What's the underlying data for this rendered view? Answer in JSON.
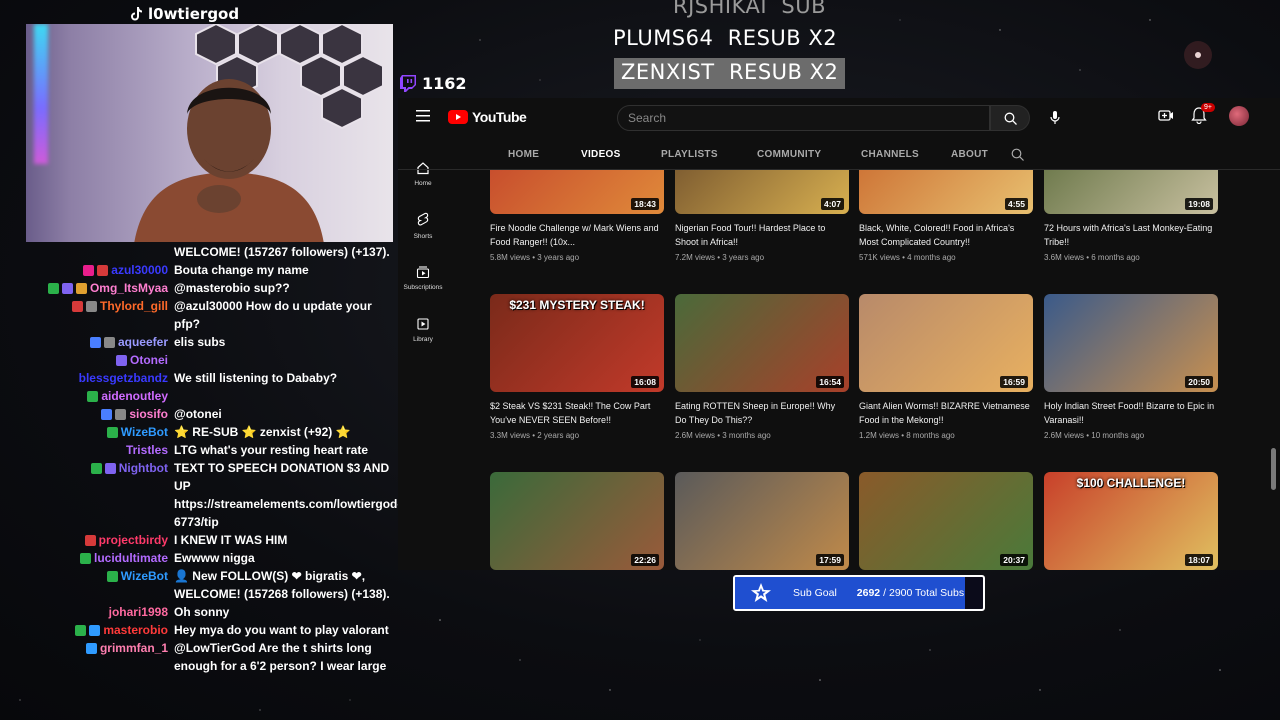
{
  "stream": {
    "channel_name": "l0wtiergod",
    "viewer_count": "1162"
  },
  "subtrain": [
    {
      "name": "RJSHIKAI",
      "action": "SUB"
    },
    {
      "name": "PLUMS64",
      "action": "RESUB X2"
    },
    {
      "name": "ZENXIST",
      "action": "RESUB X2"
    }
  ],
  "chat": [
    {
      "user": "",
      "color": "#ffffff",
      "text": "WELCOME! (157267 followers) (+137).",
      "badges": []
    },
    {
      "user": "azul30000",
      "color": "#3a3aff",
      "text": "Bouta change my name",
      "badges": [
        "#e91e8c",
        "#d63a3a"
      ]
    },
    {
      "user": "Omg_ItsMyaa",
      "color": "#ff7fd0",
      "text": "@masterobio sup??",
      "badges": [
        "#2bb14a",
        "#7f63f0",
        "#e0a030"
      ]
    },
    {
      "user": "Thylord_gill",
      "color": "#ff6a2a",
      "text": "@azul30000 How do u update your pfp?",
      "badges": [
        "#d63a3a",
        "#888888"
      ]
    },
    {
      "user": "aqueefer",
      "color": "#9a9aff",
      "text": "elis subs",
      "badges": [
        "#4a7fff",
        "#888888"
      ]
    },
    {
      "user": "Otonei",
      "color": "#b36bff",
      "text": "",
      "badges": [
        "#7f63f0"
      ]
    },
    {
      "user": "blessgetzbandz",
      "color": "#3a3aff",
      "text": "We still listening to Dababy?",
      "badges": []
    },
    {
      "user": "aidenoutley",
      "color": "#d06bff",
      "text": "",
      "badges": [
        "#2bb14a"
      ]
    },
    {
      "user": "siosifo",
      "color": "#ff7fd0",
      "text": "@otonei",
      "badges": [
        "#4a7fff",
        "#888888"
      ]
    },
    {
      "user": "WizeBot",
      "color": "#2f9bff",
      "text": "⭐ RE-SUB ⭐ zenxist (+92) ⭐",
      "badges": [
        "#2bb14a"
      ]
    },
    {
      "user": "Tristles",
      "color": "#b36bff",
      "text": "LTG what's your resting heart rate",
      "badges": []
    },
    {
      "user": "Nightbot",
      "color": "#7f63f0",
      "text": "TEXT TO SPEECH DONATION $3 AND UP https://streamelements.com/lowtiergod-6773/tip",
      "badges": [
        "#2bb14a",
        "#7f63f0"
      ]
    },
    {
      "user": "projectbirdy",
      "color": "#ff3a6a",
      "text": "I KNEW IT WAS HIM",
      "badges": [
        "#d63a3a"
      ]
    },
    {
      "user": "lucidultimate",
      "color": "#b36bff",
      "text": "Ewwww nigga",
      "badges": [
        "#2bb14a"
      ]
    },
    {
      "user": "WizeBot",
      "color": "#2f9bff",
      "text": "👤 New FOLLOW(S) ❤ bigratis ❤, WELCOME! (157268 followers) (+138).",
      "badges": [
        "#2bb14a"
      ]
    },
    {
      "user": "johari1998",
      "color": "#ff6aa0",
      "text": "Oh sonny",
      "badges": []
    },
    {
      "user": "masterobio",
      "color": "#ff3a3a",
      "text": "Hey mya do you want to play valorant",
      "badges": [
        "#2bb14a",
        "#2f9bff"
      ]
    },
    {
      "user": "grimmfan_1",
      "color": "#ff7fb0",
      "text": "@LowTierGod Are the t shirts long enough for a 6'2 person? I wear large",
      "badges": [
        "#2f9bff"
      ]
    }
  ],
  "youtube": {
    "logo": "YouTube",
    "search_placeholder": "Search",
    "notification_count": "9+",
    "sidebar": [
      {
        "label": "Home",
        "icon": "home-icon"
      },
      {
        "label": "Shorts",
        "icon": "shorts-icon"
      },
      {
        "label": "Subscriptions",
        "icon": "subscriptions-icon"
      },
      {
        "label": "Library",
        "icon": "library-icon"
      }
    ],
    "tabs": [
      "HOME",
      "VIDEOS",
      "PLAYLISTS",
      "COMMUNITY",
      "CHANNELS",
      "ABOUT"
    ],
    "active_tab": "VIDEOS",
    "videos": [
      {
        "title": "Fire Noodle Challenge w/ Mark Wiens and Food Ranger!! (10x...",
        "meta": "5.8M views • 3 years ago",
        "duration": "18:43",
        "colors": [
          "#c2402a",
          "#e08a3a"
        ]
      },
      {
        "title": "Nigerian Food Tour!! Hardest Place to Shoot in Africa!!",
        "meta": "7.2M views • 3 years ago",
        "duration": "4:07",
        "colors": [
          "#6a4a2a",
          "#d8b050"
        ]
      },
      {
        "title": "Black, White, Colored!! Food in Africa's Most Complicated Country!!",
        "meta": "571K views • 4 months ago",
        "duration": "4:55",
        "colors": [
          "#c8642a",
          "#e8c070"
        ]
      },
      {
        "title": "72 Hours with Africa's Last Monkey-Eating Tribe!!",
        "meta": "3.6M views • 6 months ago",
        "duration": "19:08",
        "colors": [
          "#5a6a3a",
          "#c8c0a0"
        ]
      },
      {
        "title": "$2 Steak VS $231 Steak!! The Cow Part You've NEVER SEEN Before!!",
        "meta": "3.3M views • 2 years ago",
        "duration": "16:08",
        "colors": [
          "#7a2a1a",
          "#c23a2a"
        ],
        "overlay": "$231 MYSTERY STEAK!"
      },
      {
        "title": "Eating ROTTEN Sheep in Europe!! Why Do They Do This??",
        "meta": "2.6M views • 3 months ago",
        "duration": "16:54",
        "colors": [
          "#4a6a3a",
          "#a8402a"
        ]
      },
      {
        "title": "Giant Alien Worms!! BIZARRE Vietnamese Food in the Mekong!!",
        "meta": "1.2M views • 8 months ago",
        "duration": "16:59",
        "colors": [
          "#b88a6a",
          "#e8b060"
        ]
      },
      {
        "title": "Holy Indian Street Food!! Bizarre to Epic in Varanasi!!",
        "meta": "2.6M views • 10 months ago",
        "duration": "20:50",
        "colors": [
          "#3a5a8a",
          "#c89050"
        ]
      },
      {
        "title": "",
        "meta": "",
        "duration": "22:26",
        "colors": [
          "#3a6a3a",
          "#9a5a3a"
        ]
      },
      {
        "title": "",
        "meta": "",
        "duration": "17:59",
        "colors": [
          "#5a5a5a",
          "#c08a4a"
        ]
      },
      {
        "title": "",
        "meta": "",
        "duration": "20:37",
        "colors": [
          "#8a5a2a",
          "#4a7a3a"
        ]
      },
      {
        "title": "",
        "meta": "",
        "duration": "18:07",
        "colors": [
          "#c8402a",
          "#e0c060"
        ],
        "overlay": "$100 CHALLENGE!"
      }
    ]
  },
  "sub_goal": {
    "label": "Sub Goal",
    "current": "2692",
    "total_text": "/ 2900 Total Subs",
    "progress": 0.928
  }
}
